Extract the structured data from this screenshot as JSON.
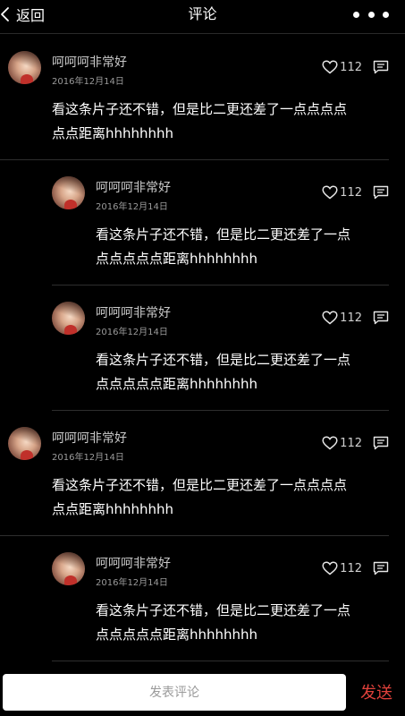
{
  "nav": {
    "back_label": "返回",
    "title": "评论"
  },
  "comments": [
    {
      "kind": "top",
      "author": "呵呵呵非常好",
      "date": "2016年12月14日",
      "likes": "112",
      "text_lines": [
        "看这条片子还不错，但是比二更还差了一点点点点",
        "点点距离hhhhhhhh"
      ]
    },
    {
      "kind": "reply",
      "author": "呵呵呵非常好",
      "date": "2016年12月14日",
      "likes": "112",
      "text_lines": [
        "看这条片子还不错，但是比二更还差了一点",
        "点点点点点距离hhhhhhhh"
      ]
    },
    {
      "kind": "reply",
      "author": "呵呵呵非常好",
      "date": "2016年12月14日",
      "likes": "112",
      "text_lines": [
        "看这条片子还不错，但是比二更还差了一点",
        "点点点点点距离hhhhhhhh"
      ]
    },
    {
      "kind": "top",
      "author": "呵呵呵非常好",
      "date": "2016年12月14日",
      "likes": "112",
      "text_lines": [
        "看这条片子还不错，但是比二更还差了一点点点点",
        "点点距离hhhhhhhh"
      ]
    },
    {
      "kind": "reply",
      "author": "呵呵呵非常好",
      "date": "2016年12月14日",
      "likes": "112",
      "text_lines": [
        "看这条片子还不错，但是比二更还差了一点",
        "点点点点点距离hhhhhhhh"
      ]
    }
  ],
  "footer": {
    "input_placeholder": "发表评论",
    "send_label": "发送"
  },
  "colors": {
    "background": "#000000",
    "send_accent": "#e0413b",
    "text_primary": "#ffffff",
    "text_secondary": "#c9c9c9"
  },
  "icons": {
    "back": "chevron-left-icon",
    "more": "more-dots-icon",
    "like": "heart-icon",
    "reply": "comment-bubble-icon"
  }
}
